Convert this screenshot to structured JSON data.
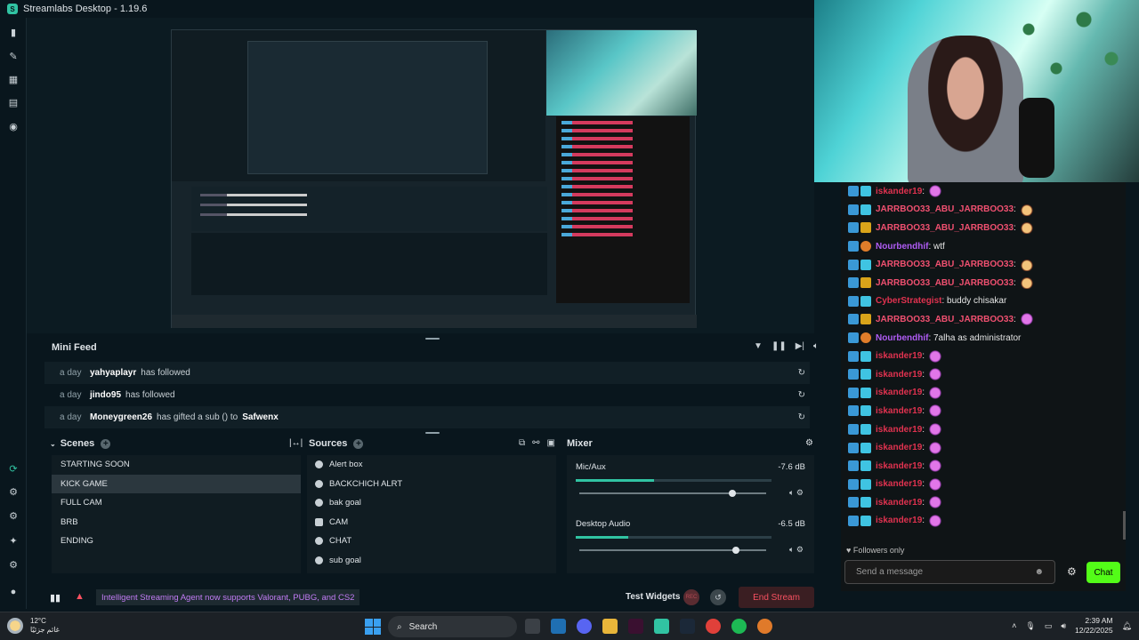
{
  "app": {
    "title": "Streamlabs Desktop - 1.19.6"
  },
  "minifeed": {
    "title": "Mini Feed",
    "events": [
      {
        "ago": "a day",
        "name": "yahyaplayr",
        "action": "has followed",
        "extra": ""
      },
      {
        "ago": "a day",
        "name": "jindo95",
        "action": "has followed",
        "extra": ""
      },
      {
        "ago": "a day",
        "name": "Moneygreen26",
        "action": "has gifted a sub () to",
        "extra": "Safwenx"
      }
    ]
  },
  "scenes": {
    "title": "Scenes",
    "items": [
      "STARTING SOON",
      "KICK GAME",
      "FULL CAM",
      "BRB",
      "ENDING"
    ],
    "selected": "KICK GAME"
  },
  "sources": {
    "title": "Sources",
    "items": [
      "Alert box",
      "BACKCHICH ALRT",
      "bak goal",
      "CAM",
      "CHAT",
      "sub goal"
    ]
  },
  "mixer": {
    "title": "Mixer",
    "channels": [
      {
        "name": "Mic/Aux",
        "db": "-7.6 dB",
        "level": 0.4,
        "volume": 0.8
      },
      {
        "name": "Desktop Audio",
        "db": "-6.5 dB",
        "level": 0.27,
        "volume": 0.82
      }
    ]
  },
  "footer": {
    "notice": "Intelligent Streaming Agent now supports Valorant, PUBG, and CS2",
    "test_widgets": "Test Widgets",
    "rec": "REC",
    "end_stream": "End Stream"
  },
  "chat": {
    "messages": [
      {
        "user": "iskander19",
        "color": "#e0324f",
        "text": ":",
        "badges": [
          "arrow",
          "blue"
        ],
        "emote": "purple"
      },
      {
        "user": "JARRBOO33_ABU_JARRBOO33",
        "color": "#f05070",
        "text": ":",
        "badges": [
          "arrow",
          "blue"
        ],
        "emote": "face"
      },
      {
        "user": "JARRBOO33_ABU_JARRBOO33",
        "color": "#f05070",
        "text": ":",
        "badges": [
          "arrow",
          "gold"
        ],
        "emote": "face"
      },
      {
        "user": "Nourbendhif",
        "color": "#b05cf5",
        "text": ": wtf",
        "badges": [
          "arrow",
          "fox"
        ],
        "emote": ""
      },
      {
        "user": "JARRBOO33_ABU_JARRBOO33",
        "color": "#f05070",
        "text": ":",
        "badges": [
          "arrow",
          "blue"
        ],
        "emote": "face"
      },
      {
        "user": "JARRBOO33_ABU_JARRBOO33",
        "color": "#f05070",
        "text": ":",
        "badges": [
          "arrow",
          "gold"
        ],
        "emote": "face"
      },
      {
        "user": "CyberStrategist",
        "color": "#e0324f",
        "text": ": buddy chisakar",
        "badges": [
          "arrow",
          "blue"
        ],
        "emote": ""
      },
      {
        "user": "JARRBOO33_ABU_JARRBOO33",
        "color": "#f05070",
        "text": ":",
        "badges": [
          "arrow",
          "gold"
        ],
        "emote": "purple"
      },
      {
        "user": "Nourbendhif",
        "color": "#b05cf5",
        "text": ": 7alha as administrator",
        "badges": [
          "arrow",
          "fox"
        ],
        "emote": ""
      },
      {
        "user": "iskander19",
        "color": "#e0324f",
        "text": ":",
        "badges": [
          "arrow",
          "blue"
        ],
        "emote": "purple"
      },
      {
        "user": "iskander19",
        "color": "#e0324f",
        "text": ":",
        "badges": [
          "arrow",
          "blue"
        ],
        "emote": "purple"
      },
      {
        "user": "iskander19",
        "color": "#e0324f",
        "text": ":",
        "badges": [
          "arrow",
          "blue"
        ],
        "emote": "purple"
      },
      {
        "user": "iskander19",
        "color": "#e0324f",
        "text": ":",
        "badges": [
          "arrow",
          "blue"
        ],
        "emote": "purple"
      },
      {
        "user": "iskander19",
        "color": "#e0324f",
        "text": ":",
        "badges": [
          "arrow",
          "blue"
        ],
        "emote": "purple"
      },
      {
        "user": "iskander19",
        "color": "#e0324f",
        "text": ":",
        "badges": [
          "arrow",
          "blue"
        ],
        "emote": "purple"
      },
      {
        "user": "iskander19",
        "color": "#e0324f",
        "text": ":",
        "badges": [
          "arrow",
          "blue"
        ],
        "emote": "purple"
      },
      {
        "user": "iskander19",
        "color": "#e0324f",
        "text": ":",
        "badges": [
          "arrow",
          "blue"
        ],
        "emote": "purple"
      },
      {
        "user": "iskander19",
        "color": "#e0324f",
        "text": ":",
        "badges": [
          "arrow",
          "blue"
        ],
        "emote": "purple"
      },
      {
        "user": "iskander19",
        "color": "#e0324f",
        "text": ":",
        "badges": [
          "arrow",
          "blue"
        ],
        "emote": "purple"
      }
    ],
    "followers_only": "Followers only",
    "placeholder": "Send a message",
    "send_label": "Chat"
  },
  "taskbar": {
    "temp": "12°C",
    "weather_desc": "غائم جزئيًا",
    "search": "Search",
    "time": "2:39 AM",
    "date": "12/22/2025"
  },
  "colors": {
    "accent": "#31c3a2",
    "kick_green": "#53fc18",
    "end_stream": "#f85161"
  }
}
